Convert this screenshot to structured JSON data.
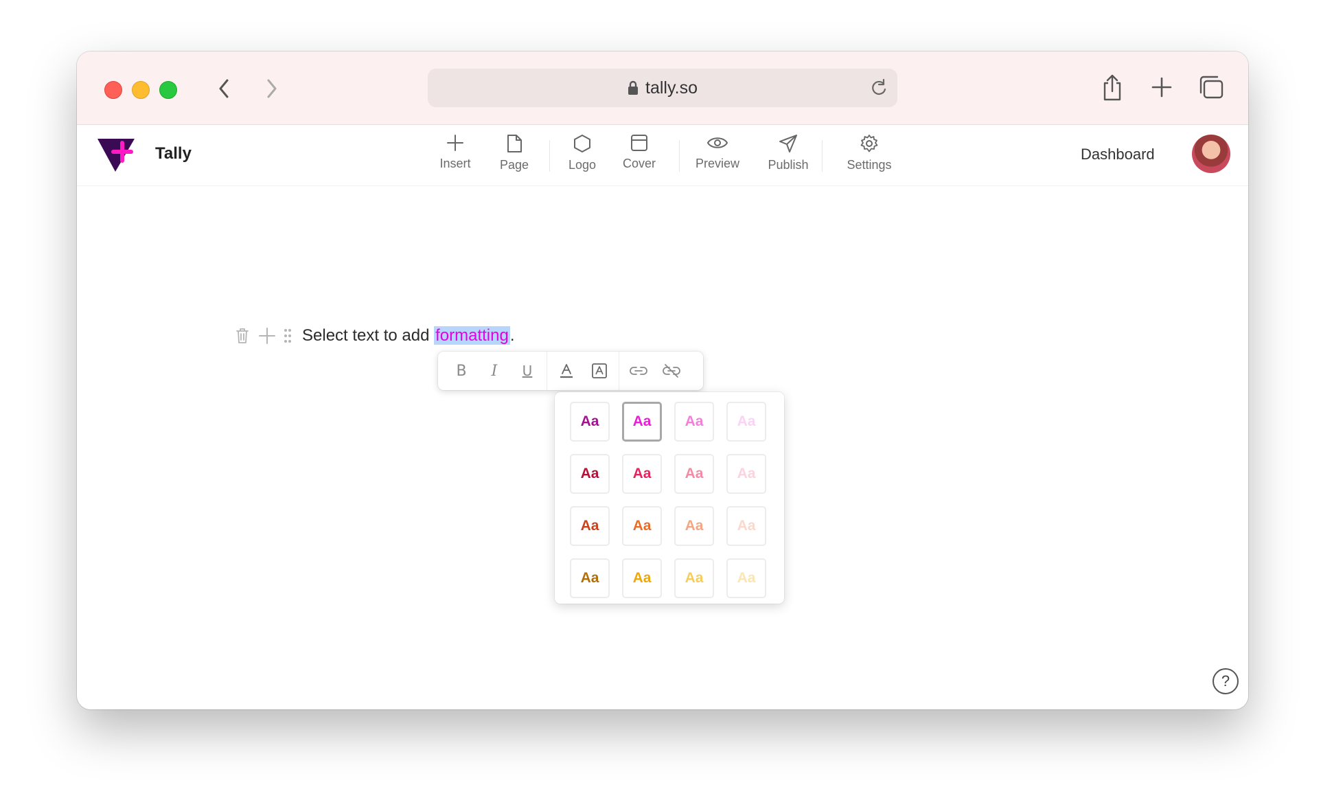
{
  "browser": {
    "url": "tally.so",
    "icons": {
      "back": "chevron-left-icon",
      "forward": "chevron-right-icon",
      "lock": "lock-icon",
      "reload": "reload-icon",
      "share": "share-icon",
      "new_tab": "plus-icon",
      "tabs": "tabs-icon"
    }
  },
  "app": {
    "brand": "Tally",
    "toolbar": [
      {
        "id": "insert",
        "label": "Insert",
        "icon": "plus-icon"
      },
      {
        "id": "page",
        "label": "Page",
        "icon": "page-icon"
      },
      {
        "id": "logo",
        "label": "Logo",
        "icon": "hexagon-icon"
      },
      {
        "id": "cover",
        "label": "Cover",
        "icon": "cover-icon"
      },
      {
        "id": "preview",
        "label": "Preview",
        "icon": "eye-icon"
      },
      {
        "id": "publish",
        "label": "Publish",
        "icon": "send-icon"
      },
      {
        "id": "settings",
        "label": "Settings",
        "icon": "gear-icon"
      }
    ],
    "dashboard_label": "Dashboard"
  },
  "editor": {
    "text_before": "Select text to add ",
    "selected_text": "formatting",
    "text_after": ".",
    "selected_color": "#e300e3",
    "selection_bg": "#b8d6fb"
  },
  "format_toolbar": {
    "bold": "B",
    "italic": "I",
    "underline": "U",
    "icons": [
      "text-color-icon",
      "highlight-icon",
      "link-icon",
      "unlink-icon"
    ]
  },
  "palette": {
    "swatch_label": "Aa",
    "selected_index": 1,
    "rows": [
      [
        "#a3128f",
        "#e91ed6",
        "#f27fd9",
        "#fbd3f4"
      ],
      [
        "#b5123a",
        "#e8245f",
        "#f48aa5",
        "#fcd3de"
      ],
      [
        "#c9431c",
        "#ea6c27",
        "#f4a683",
        "#fbd8cb"
      ],
      [
        "#b06f08",
        "#eda80e",
        "#f6cd5c",
        "#fbe6b3"
      ]
    ]
  },
  "help_label": "?"
}
